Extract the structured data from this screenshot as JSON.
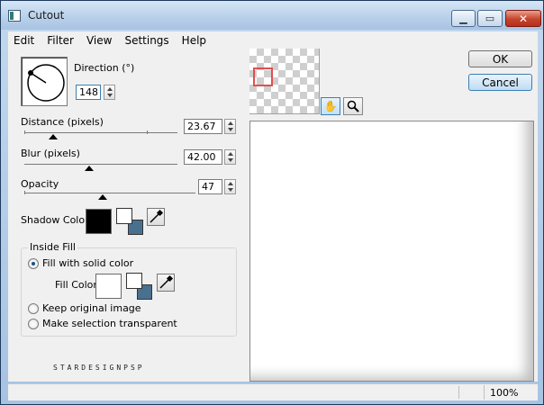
{
  "window": {
    "title": "Cutout"
  },
  "menu": [
    "Edit",
    "Filter",
    "View",
    "Settings",
    "Help"
  ],
  "direction": {
    "label": "Direction (°)",
    "value": "148"
  },
  "distance": {
    "label": "Distance (pixels)",
    "value": "23.67"
  },
  "blur": {
    "label": "Blur (pixels)",
    "value": "42.00"
  },
  "opacity": {
    "label": "Opacity",
    "value": "47"
  },
  "shadow_color": {
    "label": "Shadow Color",
    "color": "#000000",
    "swap_bg": "#4a7090"
  },
  "inside_fill": {
    "title": "Inside Fill",
    "options": [
      "Fill with solid color",
      "Keep original image",
      "Make selection transparent"
    ],
    "selected": 0,
    "fill_color_label": "Fill Color",
    "fill_color": "#ffffff"
  },
  "brand": "STARDESIGNPSP",
  "buttons": {
    "ok": "OK",
    "cancel": "Cancel"
  },
  "status": {
    "zoom": "100%"
  },
  "icons": {
    "pan": "hand-icon",
    "zoom": "magnifier-icon",
    "dropper": "eyedropper-icon"
  }
}
